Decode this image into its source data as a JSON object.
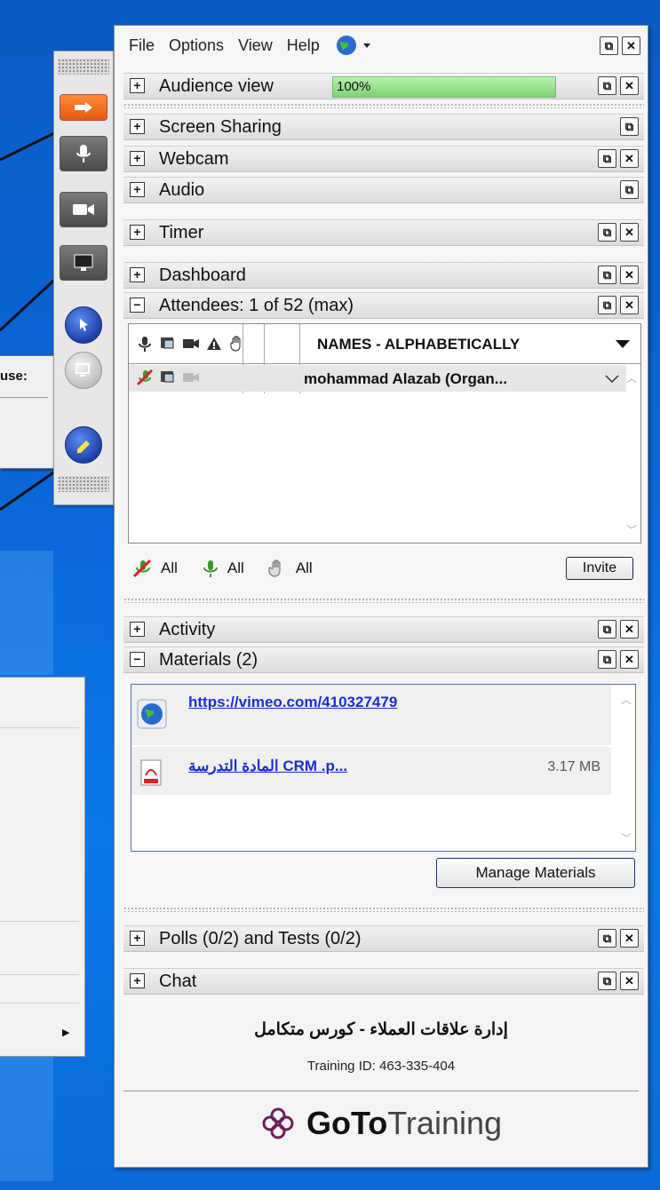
{
  "menubar": {
    "file": "File",
    "options": "Options",
    "view": "View",
    "help": "Help"
  },
  "audience": {
    "title": "Audience view",
    "progress_text": "100%",
    "progress": 1.0
  },
  "sections": {
    "screen_sharing": "Screen Sharing",
    "webcam": "Webcam",
    "audio": "Audio",
    "timer": "Timer",
    "dashboard": "Dashboard",
    "attendees": "Attendees:  1 of 52 (max)",
    "activity": "Activity",
    "materials": "Materials (2)",
    "polls": "Polls (0/2) and Tests (0/2)",
    "chat": "Chat"
  },
  "attendees_table": {
    "names_header": "NAMES - ALPHABETICALLY",
    "rows": [
      {
        "name": "mohammad Alazab (Organ..."
      }
    ]
  },
  "controls": {
    "mute_all": "All",
    "unmute_all": "All",
    "hands_all": "All",
    "invite": "Invite"
  },
  "materials_list": [
    {
      "label": "https://vimeo.com/410327479",
      "size": ""
    },
    {
      "label": "المادة التدرسة  CRM   .p...",
      "size": "3.17 MB"
    }
  ],
  "manage_materials": "Manage Materials",
  "footer": {
    "course": "إدارة علاقات العملاء - كورس متكامل",
    "training_id": "Training ID: 463-335-404",
    "brand_bold": "GoTo",
    "brand_regular": "Training"
  },
  "popup": {
    "label": "use:"
  },
  "icons": [
    "globe-icon",
    "restore-icon",
    "close-icon",
    "plus-icon",
    "minus-icon",
    "mic-icon",
    "screen-icon",
    "camera-icon",
    "warning-icon",
    "hand-icon",
    "pdf-icon",
    "gototraining-logo"
  ]
}
